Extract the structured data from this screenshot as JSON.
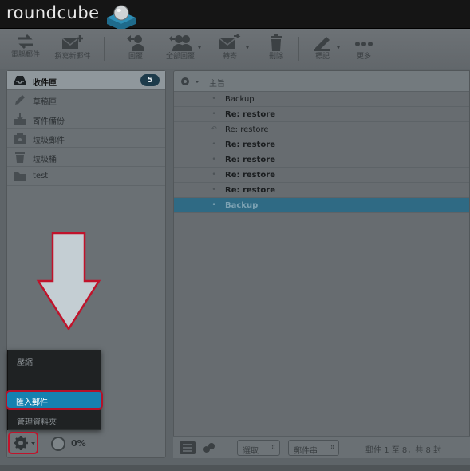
{
  "app": {
    "logo": "roundcube"
  },
  "toolbar": {
    "items": [
      {
        "label": "電腦郵件",
        "icon": "compose-icon"
      },
      {
        "label": "撰寫新郵件",
        "icon": "new-mail-icon"
      },
      {
        "label": "回覆",
        "icon": "reply-icon"
      },
      {
        "label": "全部回覆",
        "icon": "reply-all-icon"
      },
      {
        "label": "轉寄",
        "icon": "forward-icon"
      },
      {
        "label": "刪除",
        "icon": "trash-icon"
      },
      {
        "label": "標記",
        "icon": "mark-icon"
      },
      {
        "label": "更多",
        "icon": "more-icon"
      }
    ]
  },
  "folders": [
    {
      "label": "收件匣",
      "icon": "inbox-icon",
      "unread": "5"
    },
    {
      "label": "草稿匣",
      "icon": "drafts-icon"
    },
    {
      "label": "寄件備份",
      "icon": "sent-icon"
    },
    {
      "label": "垃圾郵件",
      "icon": "junk-icon"
    },
    {
      "label": "垃圾桶",
      "icon": "trash-icon"
    },
    {
      "label": "test",
      "icon": "folder-icon"
    }
  ],
  "list": {
    "subject_header": "主旨",
    "messages": [
      {
        "subject": "Backup",
        "status": "read"
      },
      {
        "subject": "Re: restore",
        "status": "unread"
      },
      {
        "subject": "Re: restore",
        "status": "replied"
      },
      {
        "subject": "Re: restore",
        "status": "unread"
      },
      {
        "subject": "Re: restore",
        "status": "unread"
      },
      {
        "subject": "Re: restore",
        "status": "unread"
      },
      {
        "subject": "Re: restore",
        "status": "unread"
      },
      {
        "subject": "Backup",
        "status": "selected"
      }
    ]
  },
  "footer": {
    "select_label": "選取",
    "threads_label": "郵件串",
    "count_text": "郵件 1 至 8，共 8 封"
  },
  "context_menu": {
    "items": [
      "壓縮",
      "",
      "匯入郵件",
      "管理資料夾"
    ]
  },
  "quota": {
    "text": "0%"
  },
  "colors": {
    "highlight": "#1581b0",
    "callout": "#c0132b",
    "badge": "#1d3b4b"
  }
}
